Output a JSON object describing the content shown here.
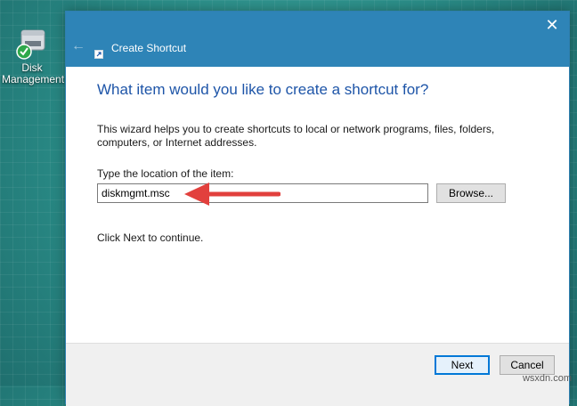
{
  "desktop": {
    "icon_label": "Disk Management",
    "icon_name": "disk-management-icon"
  },
  "window": {
    "title": "Create Shortcut",
    "close_glyph": "✕",
    "back_glyph": "←"
  },
  "wizard": {
    "heading": "What item would you like to create a shortcut for?",
    "description": "This wizard helps you to create shortcuts to local or network programs, files, folders, computers, or Internet addresses.",
    "location_label": "Type the location of the item:",
    "location_value": "diskmgmt.msc",
    "browse_label": "Browse...",
    "continue_text": "Click Next to continue."
  },
  "footer": {
    "next_label": "Next",
    "cancel_label": "Cancel"
  },
  "watermark": "wsxdn.com",
  "colors": {
    "accent": "#2e84b7",
    "heading": "#1e55a8",
    "arrow": "#e2403d"
  }
}
